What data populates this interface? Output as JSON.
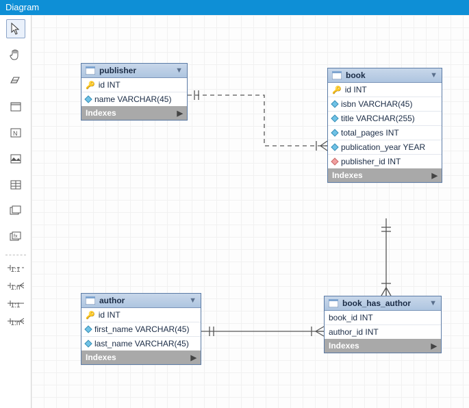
{
  "window": {
    "title": "Diagram"
  },
  "toolbar": {
    "tools": [
      {
        "name": "pointer",
        "label": "Pointer",
        "selected": true
      },
      {
        "name": "hand",
        "label": "Pan"
      },
      {
        "name": "eraser",
        "label": "Eraser"
      },
      {
        "name": "layer",
        "label": "New Layer"
      },
      {
        "name": "note",
        "label": "Text Note"
      },
      {
        "name": "image",
        "label": "Image"
      },
      {
        "name": "table",
        "label": "New Table"
      },
      {
        "name": "view",
        "label": "New View"
      },
      {
        "name": "routine",
        "label": "Routine Group"
      }
    ],
    "rel_tools": [
      {
        "name": "rel-11-ident",
        "label": "1:1"
      },
      {
        "name": "rel-1n-ident",
        "label": "1:n"
      },
      {
        "name": "rel-11-nonident",
        "label": "1:1"
      },
      {
        "name": "rel-1n-nonident",
        "label": "1:n"
      }
    ]
  },
  "entities": {
    "publisher": {
      "title": "publisher",
      "indexes_label": "Indexes",
      "columns": [
        {
          "icon": "key",
          "text": "id INT"
        },
        {
          "icon": "blue",
          "text": "name VARCHAR(45)"
        }
      ]
    },
    "book": {
      "title": "book",
      "indexes_label": "Indexes",
      "columns": [
        {
          "icon": "key",
          "text": "id INT"
        },
        {
          "icon": "blue",
          "text": "isbn VARCHAR(45)"
        },
        {
          "icon": "blue",
          "text": "title VARCHAR(255)"
        },
        {
          "icon": "blue",
          "text": "total_pages INT"
        },
        {
          "icon": "blue",
          "text": "publication_year YEAR"
        },
        {
          "icon": "red",
          "text": "publisher_id INT"
        }
      ]
    },
    "author": {
      "title": "author",
      "indexes_label": "Indexes",
      "columns": [
        {
          "icon": "key",
          "text": "id INT"
        },
        {
          "icon": "blue",
          "text": "first_name VARCHAR(45)"
        },
        {
          "icon": "blue",
          "text": "last_name VARCHAR(45)"
        }
      ]
    },
    "book_has_author": {
      "title": "book_has_author",
      "indexes_label": "Indexes",
      "columns": [
        {
          "icon": "none",
          "text": "book_id INT"
        },
        {
          "icon": "none",
          "text": "author_id INT"
        }
      ]
    }
  },
  "relationships": [
    {
      "from": "publisher",
      "to": "book",
      "type": "1:n",
      "identifying": false
    },
    {
      "from": "book",
      "to": "book_has_author",
      "type": "1:n",
      "identifying": true
    },
    {
      "from": "author",
      "to": "book_has_author",
      "type": "1:n",
      "identifying": true
    }
  ]
}
